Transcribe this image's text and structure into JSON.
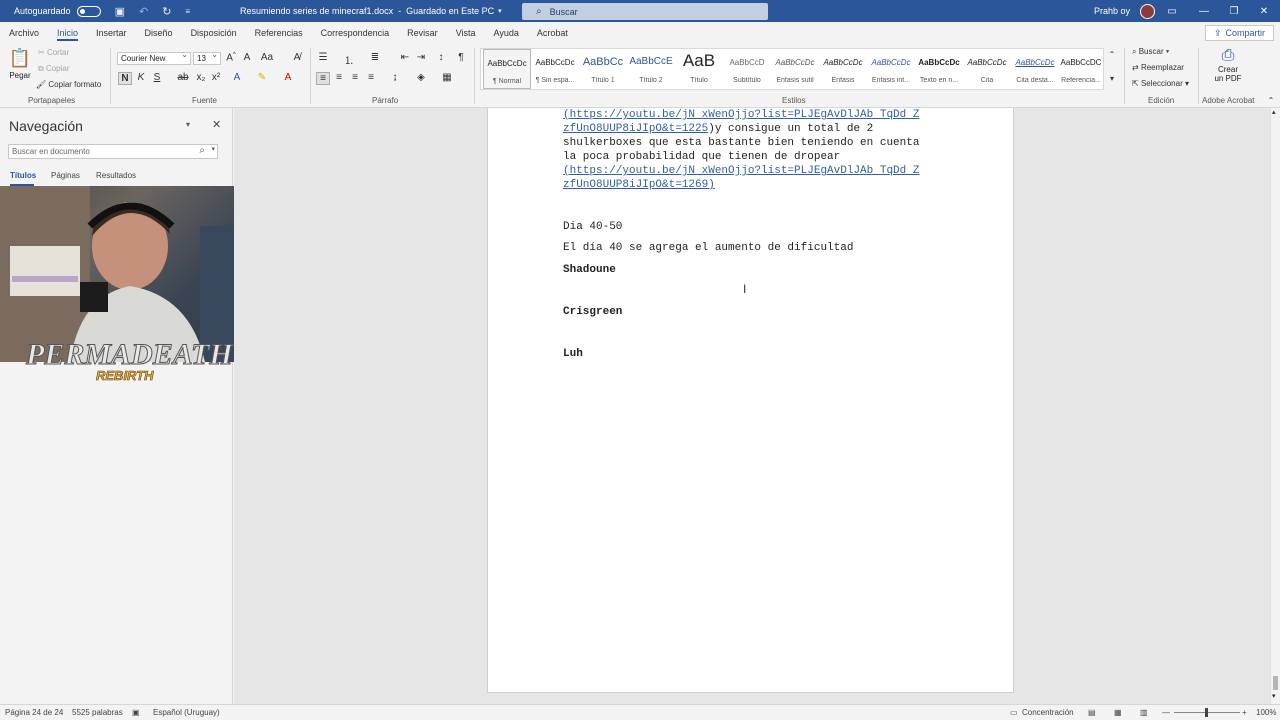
{
  "titlebar": {
    "autosave_label": "Autoguardado",
    "doc_name": "Resumiendo series de minecraf1.docx",
    "save_status": "Guardado en Este PC",
    "search_label": "Buscar",
    "user_name": "Prahb oy"
  },
  "menu": {
    "tabs": [
      "Archivo",
      "Inicio",
      "Insertar",
      "Diseño",
      "Disposición",
      "Referencias",
      "Correspondencia",
      "Revisar",
      "Vista",
      "Ayuda",
      "Acrobat"
    ],
    "active_tab": "Inicio",
    "share_label": "Compartir"
  },
  "ribbon": {
    "clipboard": {
      "paste": "Pegar",
      "cut": "Cortar",
      "copy": "Copiar",
      "format_painter": "Copiar formato",
      "label": "Portapapeles"
    },
    "font": {
      "font_name": "Courier New",
      "font_size": "13",
      "bold": "N",
      "italic": "K",
      "underline": "S",
      "label": "Fuente"
    },
    "paragraph": {
      "label": "Párrafo"
    },
    "styles": {
      "label": "Estilos",
      "items": [
        {
          "sample": "AaBbCcDc",
          "name": "¶ Normal"
        },
        {
          "sample": "AaBbCcDc",
          "name": "¶ Sin espa..."
        },
        {
          "sample": "AaBbCc",
          "name": "Título 1"
        },
        {
          "sample": "AaBbCcE",
          "name": "Título 2"
        },
        {
          "sample": "AaB",
          "name": "Título"
        },
        {
          "sample": "AaBbCcD",
          "name": "Subtítulo"
        },
        {
          "sample": "AaBbCcDc",
          "name": "Énfasis sutil"
        },
        {
          "sample": "AaBbCcDc",
          "name": "Énfasis"
        },
        {
          "sample": "AaBbCcDc",
          "name": "Énfasis int..."
        },
        {
          "sample": "AaBbCcDc",
          "name": "Texto en n..."
        },
        {
          "sample": "AaBbCcDc",
          "name": "Cita"
        },
        {
          "sample": "AaBbCcDc",
          "name": "Cita desta..."
        },
        {
          "sample": "AaBbCcDC",
          "name": "Referencia..."
        }
      ]
    },
    "editing": {
      "find": "Buscar",
      "replace": "Reemplazar",
      "select": "Seleccionar",
      "label": "Edición"
    },
    "acrobat": {
      "create_pdf_1": "Crear",
      "create_pdf_2": "un PDF",
      "label": "Adobe Acrobat"
    }
  },
  "nav": {
    "title": "Navegación",
    "search_placeholder": "Buscar en documento",
    "tabs": [
      "Títulos",
      "Páginas",
      "Resultados"
    ],
    "logo_text": "PERMADEATH",
    "logo_sub": "REBIRTH"
  },
  "document": {
    "lines": [
      {
        "kind": "link",
        "text": "(https://youtu.be/jN xWenOjjo?list=PLJEgAvDlJAb TqDd Z"
      },
      {
        "kind": "mixed",
        "link": "zfUnO8UUP8iJIpO&t=1225",
        "after": ")y consigue un total de 2"
      },
      {
        "kind": "text",
        "text": "shulkerboxes que esta bastante bien teniendo en cuenta"
      },
      {
        "kind": "text",
        "text": "la poca probabilidad que tienen de dropear"
      },
      {
        "kind": "link",
        "text": "(https://youtu.be/jN xWenOjjo?list=PLJEgAvDlJAb TqDd Z"
      },
      {
        "kind": "link",
        "text": "zfUnO8UUP8iJIpO&t=1269)"
      }
    ],
    "day_heading": "Dia 40-50",
    "day_text": "El día 40 se agrega el aumento de dificultad",
    "names": [
      "Shadoune",
      "Crisgreen",
      "Luh"
    ]
  },
  "status": {
    "page": "Página 24 de 24",
    "words": "5525 palabras",
    "language": "Español (Uruguay)",
    "focus": "Concentración",
    "zoom": "100%"
  }
}
